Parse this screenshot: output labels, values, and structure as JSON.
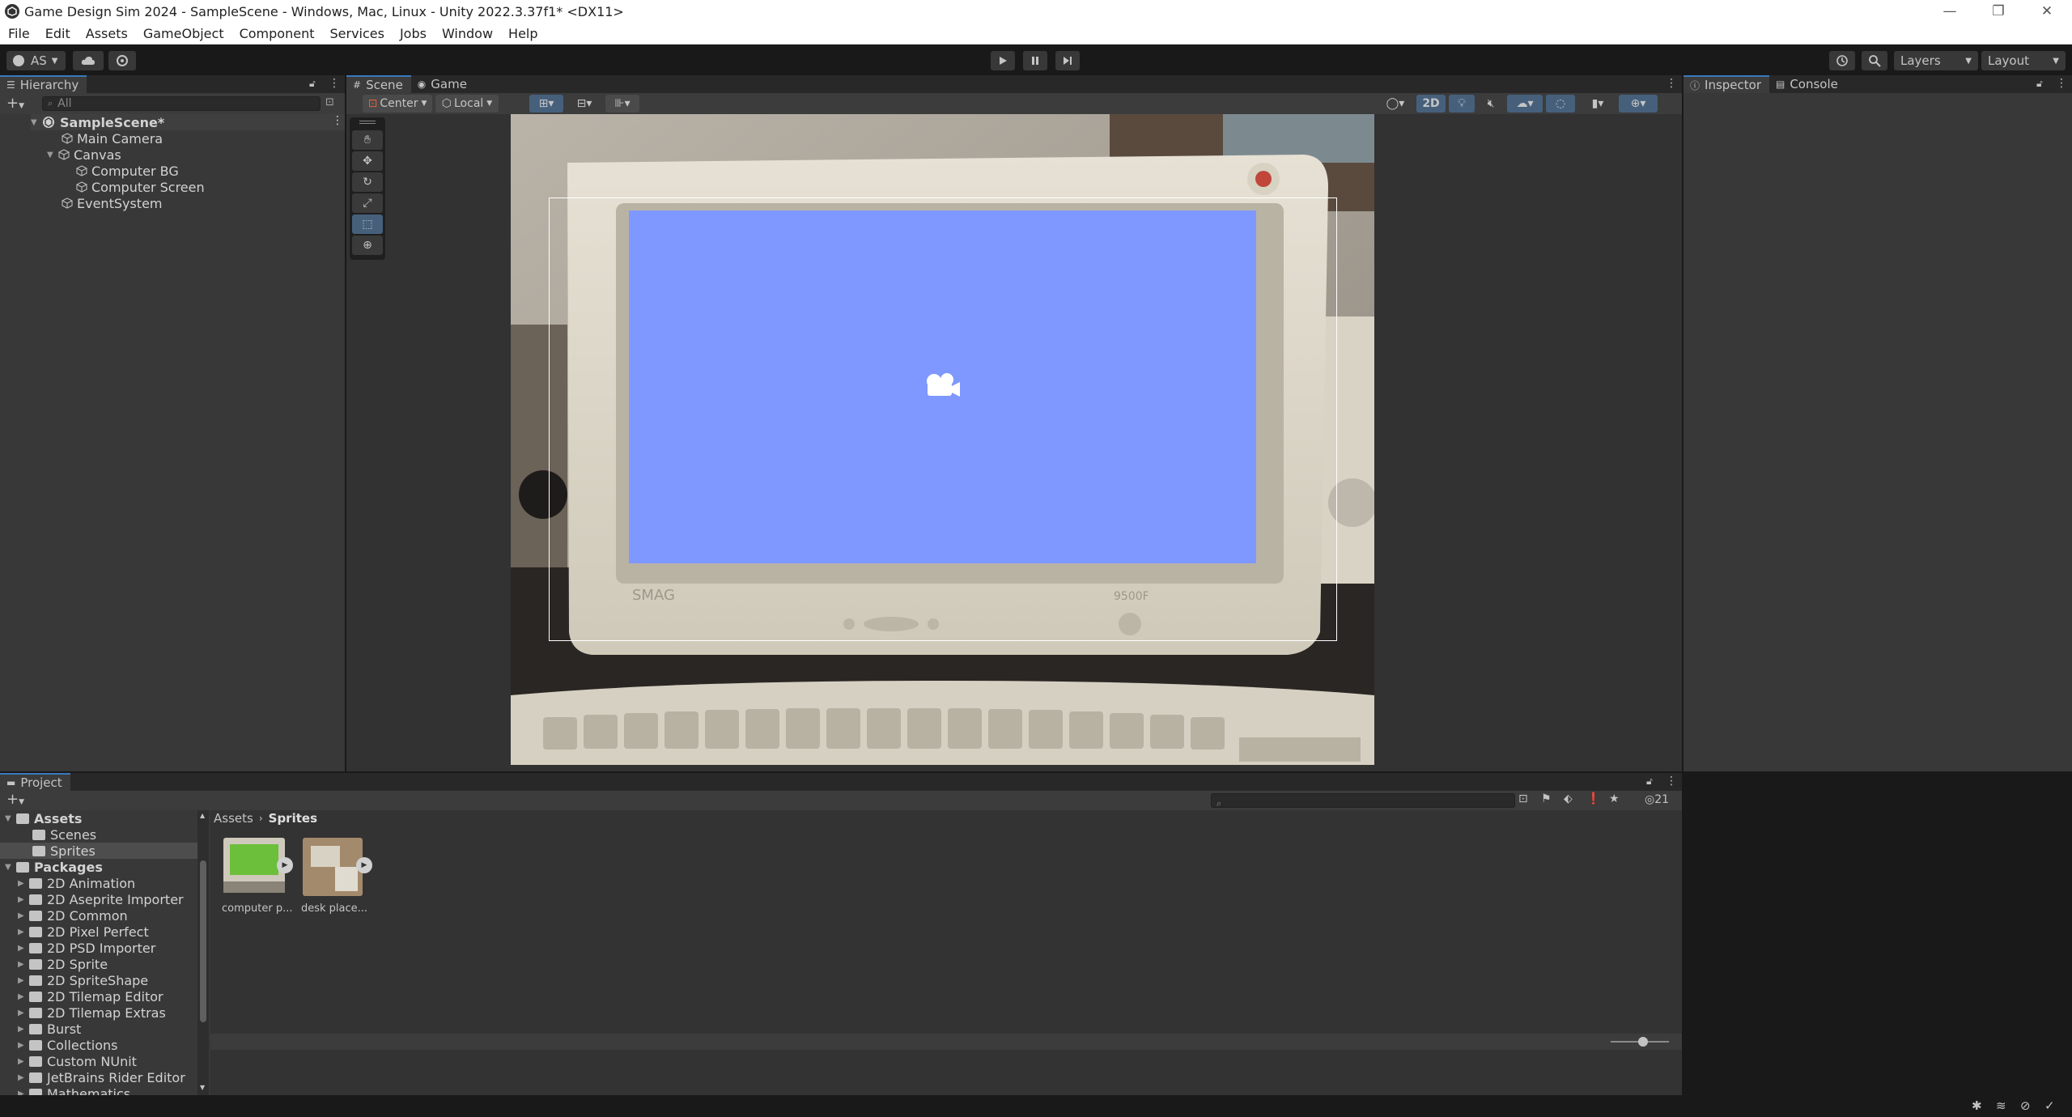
{
  "window": {
    "title": "Game Design Sim 2024 - SampleScene - Windows, Mac, Linux - Unity 2022.3.37f1* <DX11>",
    "minimize": "—",
    "maximize": "❐",
    "close": "✕"
  },
  "menu": [
    "File",
    "Edit",
    "Assets",
    "GameObject",
    "Component",
    "Services",
    "Jobs",
    "Window",
    "Help"
  ],
  "toolbar": {
    "account": "AS",
    "layers": "Layers",
    "layout": "Layout"
  },
  "hierarchy": {
    "tab": "Hierarchy",
    "search_placeholder": "All",
    "scene": "SampleScene*",
    "items": [
      {
        "label": "Main Camera"
      },
      {
        "label": "Canvas"
      },
      {
        "label": "Computer BG"
      },
      {
        "label": "Computer Screen"
      },
      {
        "label": "EventSystem"
      }
    ]
  },
  "scene_view": {
    "tabs": [
      "Scene",
      "Game"
    ],
    "pivot": "Center",
    "space": "Local",
    "mode_2d": "2D",
    "screen_color": "#7f98ff"
  },
  "right_panel": {
    "tabs": [
      "Inspector",
      "Console"
    ]
  },
  "project": {
    "tab": "Project",
    "count": "21",
    "tree": {
      "assets": "Assets",
      "asset_folders": [
        "Scenes",
        "Sprites"
      ],
      "packages": "Packages",
      "package_folders": [
        "2D Animation",
        "2D Aseprite Importer",
        "2D Common",
        "2D Pixel Perfect",
        "2D PSD Importer",
        "2D Sprite",
        "2D SpriteShape",
        "2D Tilemap Editor",
        "2D Tilemap Extras",
        "Burst",
        "Collections",
        "Custom NUnit",
        "JetBrains Rider Editor",
        "Mathematics"
      ]
    },
    "breadcrumb": [
      "Assets",
      "Sprites"
    ],
    "files": [
      {
        "label": "computer p..."
      },
      {
        "label": "desk place..."
      }
    ]
  },
  "icons": [
    "unity-logo-icon",
    "account-icon",
    "cloud-icon",
    "settings-icon",
    "play-icon",
    "pause-icon",
    "step-icon",
    "history-icon",
    "search-icon",
    "hand-tool-icon",
    "move-tool-icon",
    "rotate-tool-icon",
    "scale-tool-icon",
    "rect-tool-icon",
    "transform-tool-icon",
    "camera-gizmo-icon",
    "folder-icon",
    "gameobject-icon",
    "lock-icon"
  ]
}
